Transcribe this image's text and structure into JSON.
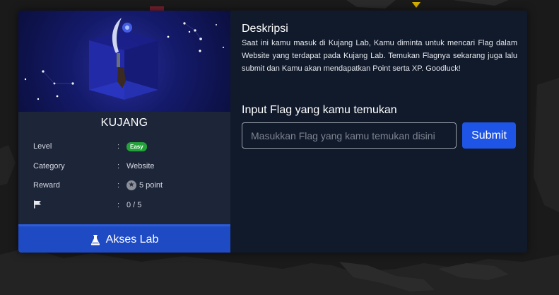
{
  "card": {
    "title": "KUJANG",
    "rows": [
      {
        "label": "Level",
        "colon": ":",
        "value": "Easy"
      },
      {
        "label": "Category",
        "colon": ":",
        "value": "Website"
      },
      {
        "label": "Reward",
        "colon": ":",
        "value": "5 point"
      },
      {
        "label": "",
        "colon": ":",
        "value": "0 / 5"
      }
    ],
    "level_color": "#22a33a",
    "access_button": "Akses Lab",
    "icons": {
      "reward": "star-icon",
      "solves": "flag-icon",
      "access": "flask-icon"
    }
  },
  "description": {
    "title": "Deskripsi",
    "text": "Saat ini kamu masuk di Kujang Lab, Kamu diminta untuk mencari Flag dalam Website yang terdapat pada Kujang Lab. Temukan Flagnya sekarang juga lalu submit dan Kamu akan mendapatkan Point serta XP. Goodluck!"
  },
  "flag_form": {
    "title": "Input Flag yang kamu temukan",
    "placeholder": "Masukkan Flag yang kamu temukan disini",
    "value": "",
    "submit_label": "Submit"
  },
  "colors": {
    "primary": "#1e55e6",
    "panel": "#111a2b",
    "sidebar": "#1d2538"
  }
}
